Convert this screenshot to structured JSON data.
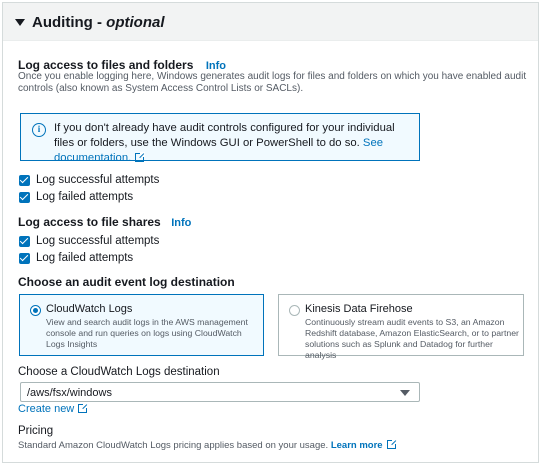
{
  "header": {
    "title": "Auditing",
    "title_suffix": "optional",
    "separator": " - "
  },
  "files_folders": {
    "label": "Log access to files and folders",
    "info": "Info",
    "description": "Once you enable logging here, Windows generates audit logs for files and folders on which you have enabled audit controls (also known as System Access Control Lists or SACLs)."
  },
  "alert": {
    "icon": "info-circle-icon",
    "text": "If you don't already have audit controls configured for your individual files or folders, use the Windows GUI or PowerShell to do so.",
    "link": "See documentation."
  },
  "files_checkboxes": [
    {
      "label": "Log successful attempts",
      "checked": true
    },
    {
      "label": "Log failed attempts",
      "checked": true
    }
  ],
  "file_shares": {
    "label": "Log access to file shares",
    "info": "Info"
  },
  "shares_checkboxes": [
    {
      "label": "Log successful attempts",
      "checked": true
    },
    {
      "label": "Log failed attempts",
      "checked": true
    }
  ],
  "destination": {
    "label": "Choose an audit event log destination",
    "options": [
      {
        "title": "CloudWatch Logs",
        "description": "View and search audit logs in the AWS management console and run queries on logs using CloudWatch Logs Insights",
        "selected": true
      },
      {
        "title": "Kinesis Data Firehose",
        "description": "Continuously stream audit events to S3, an Amazon Redshift database, Amazon ElasticSearch, or to partner solutions such as Splunk and Datadog for further analysis",
        "selected": false
      }
    ]
  },
  "cloudwatch_dest": {
    "label": "Choose a CloudWatch Logs destination",
    "value": "/aws/fsx/windows",
    "create_new": "Create new"
  },
  "pricing": {
    "label": "Pricing",
    "text": "Standard Amazon CloudWatch Logs pricing applies based on your usage.",
    "link": "Learn more"
  },
  "colors": {
    "accent": "#0073bb",
    "alert_bg": "#f1faff",
    "header_bg": "#f2f3f3"
  }
}
